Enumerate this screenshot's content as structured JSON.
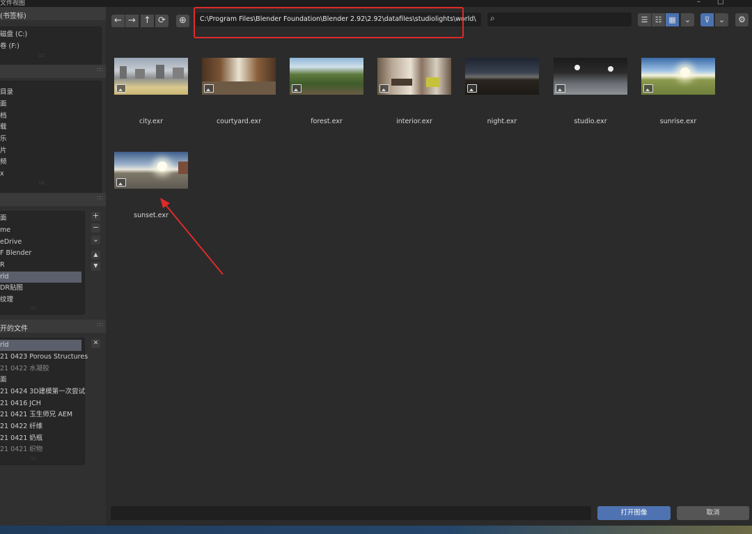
{
  "window": {
    "title": "文件视图"
  },
  "sidebar": {
    "volumes": {
      "header": "(书签标)",
      "items": [
        "磁盘 (C:)",
        "卷 (F:)"
      ]
    },
    "system": {
      "items": [
        "目录",
        "面",
        "档",
        "载",
        "乐",
        "片",
        "频",
        "x"
      ]
    },
    "bookmarks": {
      "items": [
        "面",
        "me",
        "eDrive",
        "F Blender",
        "R",
        "rld",
        "DR贴图",
        "纹理"
      ],
      "selected": 5
    },
    "recent": {
      "header": "开的文件",
      "items": [
        {
          "label": "rld",
          "dim": false
        },
        {
          "label": "21 0423 Porous Structures",
          "dim": false
        },
        {
          "label": "21 0422 水凝胶",
          "dim": true
        },
        {
          "label": "面",
          "dim": false
        },
        {
          "label": "21 0424 3D建模第一次尝试",
          "dim": false
        },
        {
          "label": "21 0416 JCH",
          "dim": false
        },
        {
          "label": "21 0421 玉生师兄 AEM",
          "dim": false
        },
        {
          "label": "21 0422 纤维",
          "dim": false
        },
        {
          "label": "21 0421 奶瓶",
          "dim": false
        },
        {
          "label": "21 0421 织物",
          "dim": true
        }
      ],
      "selected": 0
    },
    "buttons": {
      "add": "+",
      "remove": "−",
      "menu": "⌄",
      "up": "▲",
      "down": "▼",
      "close": "✕"
    }
  },
  "toolbar": {
    "back": "←",
    "forward": "→",
    "parent": "↑",
    "refresh": "⟳",
    "new_folder": "⊕",
    "path": "C:\\Program Files\\Blender Foundation\\Blender 2.92\\2.92\\datafiles\\studiolights\\world\\",
    "search_placeholder": "",
    "search_icon": "⌕",
    "view_list": "☰",
    "view_detail": "☷",
    "view_thumb": "▦",
    "view_dropdown": "⌄",
    "filter": "⊽",
    "filter_dropdown": "⌄",
    "settings": "⚙"
  },
  "files": [
    {
      "name": "city.exr"
    },
    {
      "name": "courtyard.exr"
    },
    {
      "name": "forest.exr"
    },
    {
      "name": "interior.exr"
    },
    {
      "name": "night.exr"
    },
    {
      "name": "studio.exr"
    },
    {
      "name": "sunrise.exr"
    },
    {
      "name": "sunset.exr"
    }
  ],
  "footer": {
    "filename": "",
    "open_label": "打开图像",
    "cancel_label": "取消"
  },
  "colors": {
    "accent": "#4f73b2",
    "highlight": "#e02a2a",
    "background": "#2b2b2b"
  }
}
